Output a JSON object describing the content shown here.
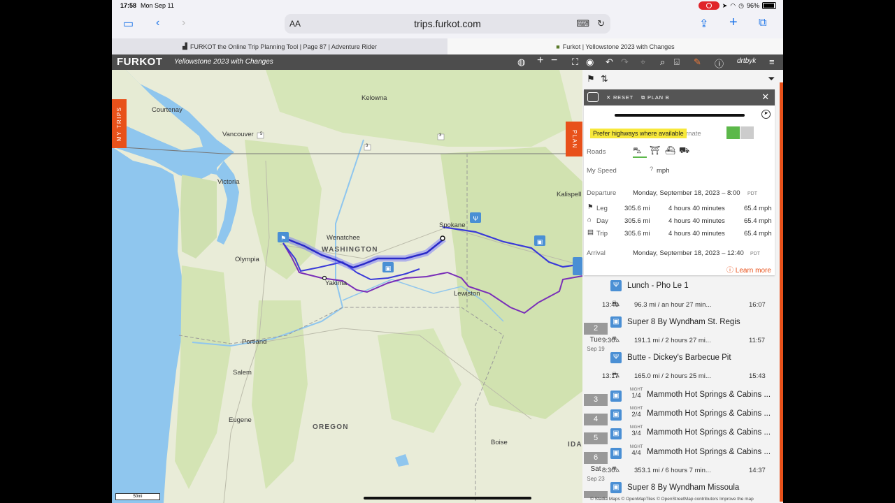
{
  "status_bar": {
    "time": "17:58",
    "date": "Mon Sep 11",
    "battery": "96%"
  },
  "browser": {
    "text_size_label": "AA",
    "url": "trips.furkot.com",
    "tabs": [
      {
        "label": "FURKOT the Online Trip Planning Tool | Page 87 | Adventure Rider",
        "active": false
      },
      {
        "label": "Furkot | Yellowstone 2023 with Changes",
        "active": true
      }
    ]
  },
  "app": {
    "logo": "FURKOT",
    "trip_title": "Yellowstone 2023 with Changes",
    "user": "drtbyk",
    "my_trips_tab": "MY TRIPS",
    "plan_tab": "PLAN"
  },
  "map": {
    "labels": {
      "courtenay": "Courtenay",
      "kelowna": "Kelowna",
      "vancouver": "Vancouver",
      "victoria": "Victoria",
      "kalispell": "Kalispell",
      "spokane": "Spokane",
      "wenatchee": "Wenatchee",
      "washington": "WASHINGTON",
      "olympia": "Olympia",
      "yakima": "Yakima",
      "lewiston": "Lewiston",
      "portland": "Portland",
      "salem": "Salem",
      "eugene": "Eugene",
      "oregon": "OREGON",
      "boise": "Boise",
      "ida": "IDA"
    },
    "highway_shields": [
      "5",
      "3",
      "3"
    ],
    "scale": "50mi",
    "attribution": "© Stadia Maps  © OpenMapTiles  © OpenStreetMap contributors  Improve the map",
    "colors": {
      "route_selected": "#3a3ad8",
      "route_alt": "#7a2fb8",
      "water": "#8fc6ee",
      "land": "#e9ecd8",
      "accent": "#e8511a"
    }
  },
  "plan": {
    "reset_label": "RESET",
    "planb_label": "PLAN B",
    "tooltip": "Prefer highways where available",
    "alternate_label": "rnate",
    "roads_label": "Roads",
    "speed_label": "My Speed",
    "speed_value": "?",
    "speed_unit": "mph",
    "departure_label": "Departure",
    "departure_value": "Monday, September 18, 2023  –  8:00",
    "departure_tz": "PDT",
    "stats": [
      {
        "label": "Leg",
        "distance": "305.6 mi",
        "duration": "4 hours 40 minutes",
        "speed": "65.4 mph"
      },
      {
        "label": "Day",
        "distance": "305.6 mi",
        "duration": "4 hours 40 minutes",
        "speed": "65.4 mph"
      },
      {
        "label": "Trip",
        "distance": "305.6 mi",
        "duration": "4 hours 40 minutes",
        "speed": "65.4 mph"
      }
    ],
    "arrival_label": "Arrival",
    "arrival_value": "Monday, September 18, 2023  –  12:40",
    "arrival_tz": "PDT",
    "learn_more": "Learn more"
  },
  "itinerary": {
    "stop1": {
      "name": "Lunch - Pho Le 1",
      "icon": "fork-knife-icon"
    },
    "drive1": {
      "start": "13:40",
      "info": "96.3 mi / an hour 27 min...",
      "end": "16:07"
    },
    "day2": {
      "num": "2",
      "dow": "Tue",
      "date": "Sep 19"
    },
    "stop2": {
      "name": "Super 8 By Wyndham St. Regis",
      "icon": "hotel-icon"
    },
    "drive2": {
      "start": "9:30",
      "info": "191.1 mi / 2 hours 27 mi...",
      "end": "11:57"
    },
    "stop3": {
      "name": "Butte - Dickey's Barbecue Pit",
      "icon": "fork-knife-icon"
    },
    "drive3": {
      "start": "13:17",
      "info": "165.0 mi / 2 hours 25 mi...",
      "end": "15:43"
    },
    "nights": [
      {
        "day": "3",
        "label": "NIGHT",
        "fraction": "1/4",
        "name": "Mammoth Hot Springs & Cabins ..."
      },
      {
        "day": "4",
        "label": "NIGHT",
        "fraction": "2/4",
        "name": "Mammoth Hot Springs & Cabins ..."
      },
      {
        "day": "5",
        "label": "NIGHT",
        "fraction": "3/4",
        "name": "Mammoth Hot Springs & Cabins ..."
      },
      {
        "day": "",
        "label": "NIGHT",
        "fraction": "4/4",
        "name": "Mammoth Hot Springs & Cabins ..."
      }
    ],
    "day6": {
      "num": "6",
      "dow": "Sat",
      "date": "Sep 23"
    },
    "drive4": {
      "start": "8:30",
      "info": "353.1 mi / 6 hours 7 min...",
      "end": "14:37"
    },
    "stop4": {
      "name": "Super 8 By Wyndham Missoula",
      "icon": "hotel-icon"
    }
  }
}
